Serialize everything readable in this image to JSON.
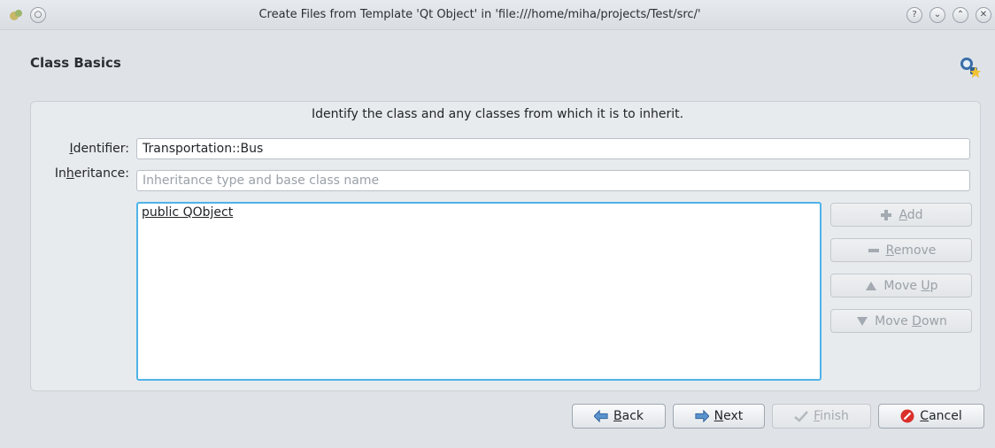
{
  "window": {
    "title": "Create Files from Template 'Qt Object' in 'file:///home/miha/projects/Test/src/'",
    "controls": [
      "help",
      "minimize",
      "maximize",
      "close"
    ]
  },
  "page": {
    "title": "Class Basics",
    "instruction": "Identify the class and any classes from which it is to inherit."
  },
  "identifier": {
    "label_prefix": "",
    "label_mnemonic": "I",
    "label_rest": "dentifier:",
    "value": "Transportation::Bus"
  },
  "inheritance": {
    "label_prefix": "In",
    "label_mnemonic": "h",
    "label_rest": "eritance:",
    "placeholder": "Inheritance type and base class name",
    "items": [
      "public QObject"
    ]
  },
  "side_buttons": {
    "add": {
      "pre": "",
      "mn": "A",
      "post": "dd"
    },
    "remove": {
      "pre": "",
      "mn": "R",
      "post": "emove"
    },
    "move_up": {
      "pre": "Move ",
      "mn": "U",
      "post": "p"
    },
    "move_down": {
      "pre": "Move ",
      "mn": "D",
      "post": "own"
    }
  },
  "nav_buttons": {
    "back": {
      "mn": "B",
      "post": "ack"
    },
    "next": {
      "mn": "N",
      "post": "ext"
    },
    "finish": {
      "mn": "F",
      "post": "inish"
    },
    "cancel": {
      "mn": "C",
      "post": "ancel"
    }
  },
  "colors": {
    "focus_border": "#4fb3e8",
    "cancel_red": "#d9302c",
    "arrow_blue": "#3a7fc4"
  }
}
